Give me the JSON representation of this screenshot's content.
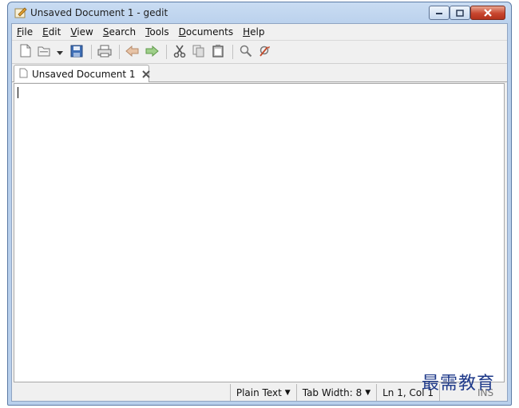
{
  "window": {
    "title": "Unsaved Document 1 - gedit"
  },
  "menubar": {
    "items": [
      {
        "u": "F",
        "rest": "ile"
      },
      {
        "u": "E",
        "rest": "dit"
      },
      {
        "u": "V",
        "rest": "iew"
      },
      {
        "u": "S",
        "rest": "earch"
      },
      {
        "u": "T",
        "rest": "ools"
      },
      {
        "u": "D",
        "rest": "ocuments"
      },
      {
        "u": "H",
        "rest": "elp"
      }
    ]
  },
  "toolbar": {
    "icons": [
      "new-document-icon",
      "open-icon",
      "recent-dropdown-icon",
      "save-icon",
      "print-icon",
      "undo-icon",
      "redo-icon",
      "cut-icon",
      "copy-icon",
      "paste-icon",
      "find-icon",
      "replace-icon"
    ]
  },
  "tabs": [
    {
      "label": "Unsaved Document 1"
    }
  ],
  "statusbar": {
    "language": "Plain Text",
    "tab_width": "Tab Width: 8",
    "position": "Ln 1, Col 1",
    "mode": "INS"
  },
  "watermark": "最需教育",
  "colors": {
    "titlebar": "#b9d0ec",
    "close": "#c8462f",
    "accent": "#1f3a8a"
  }
}
